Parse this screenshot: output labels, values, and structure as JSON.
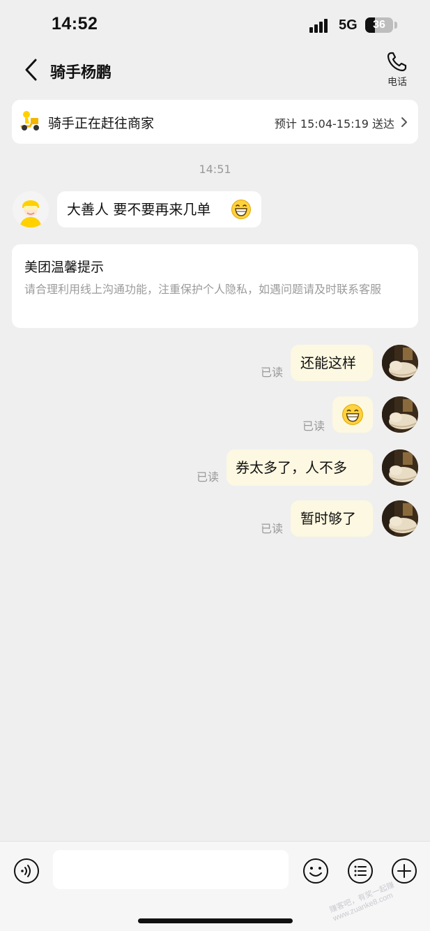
{
  "status_bar": {
    "time": "14:52",
    "network": "5G",
    "battery": "36",
    "battery_level": 0.36
  },
  "nav": {
    "title": "骑手杨鹏",
    "call_label": "电话",
    "back_icon": "chevron-left-icon",
    "call_icon": "phone-icon"
  },
  "status_card": {
    "text": "骑手正在赶往商家",
    "eta": "预计 15:04-15:19 送达",
    "icon": "scooter-rider-icon"
  },
  "messages": {
    "timestamp": "14:51",
    "rider_message": "大善人 要不要再来几单",
    "rider_emoji": "grinning-face-icon",
    "tip_title": "美团温馨提示",
    "tip_body": "请合理利用线上沟通功能，注重保护个人隐私，如遇问题请及时联系客服",
    "outgoing": [
      {
        "text": "还能这样",
        "status": "已读"
      },
      {
        "text": "",
        "emoji": "grinning-face-icon",
        "status": "已读"
      },
      {
        "text": "券太多了，人不多",
        "status": "已读"
      },
      {
        "text": "暂时够了",
        "status": "已读"
      }
    ]
  },
  "bottom_bar": {
    "voice_icon": "voice-icon",
    "emoji_icon": "smiley-icon",
    "quick_reply_icon": "list-icon",
    "more_icon": "plus-icon",
    "input_value": "",
    "input_placeholder": ""
  },
  "colors": {
    "background": "#efefef",
    "incoming_bubble": "#ffffff",
    "outgoing_bubble": "#fdf8e1",
    "brand_yellow": "#ffd100"
  },
  "watermark": "赚客吧，有奖一起赚 www.zuanke8.com"
}
